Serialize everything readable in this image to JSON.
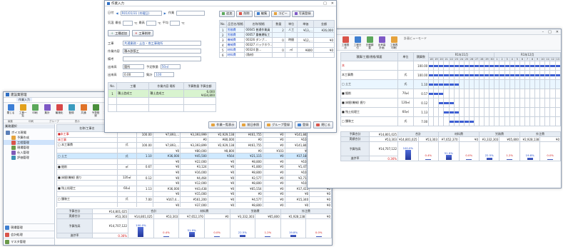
{
  "left_window": {
    "title": "建設業管理",
    "tab": "作業入力",
    "ribbon": [
      {
        "label": "閉じる",
        "color": "#3d7fd6"
      },
      {
        "label": "工事一覧",
        "color": "#e2a11c"
      },
      {
        "label": "印刷",
        "color": "#5ba85b"
      },
      {
        "label": "集計",
        "color": "#7e59c6"
      },
      {
        "label": "最適化",
        "color": "#d84848"
      },
      {
        "label": "登録",
        "color": "#3a9bbf"
      },
      {
        "label": "共通",
        "color": "#e07328"
      },
      {
        "label": "予算登録",
        "color": "#4a8f3c"
      },
      {
        "label": "実行予算",
        "color": "#c7499b"
      }
    ],
    "ribbon_groups": [
      "編集",
      "印刷",
      "グループ",
      "表示"
    ],
    "nav_title": "業務選択",
    "tree": [
      {
        "label": "ボイス現場",
        "level": 0
      },
      {
        "label": "予算作成",
        "level": 1
      },
      {
        "label": "工程管理",
        "level": 1
      },
      {
        "label": "現場管理",
        "level": 1
      },
      {
        "label": "仕入管理",
        "level": 1
      },
      {
        "label": "評価管理",
        "level": 1
      }
    ],
    "bottom_nav": [
      "現場管理",
      "会計処理",
      "マスタ管理"
    ]
  },
  "mid_table": {
    "headers": [
      "名称/工事名",
      "単位",
      "数量",
      "予算",
      "",
      "実行",
      "",
      "実績",
      "",
      "差額"
    ],
    "rows": [
      {
        "name": "■本工事",
        "unit": "",
        "qty": "100.00",
        "v1": "¥7,893,…",
        "v2": "¥3,393,999",
        "v3": "¥2,929,138",
        "v4": "¥461,755",
        "v5": "¥0",
        "v6": "¥141,844",
        "v7": "¥0",
        "cls": "red"
      },
      {
        "name": "床工事",
        "unit": "",
        "qty": "",
        "v1": "",
        "v2": "¥0",
        "v3": "¥80,000",
        "v4": "¥0",
        "v5": "¥0",
        "v6": "¥103",
        "v7": "¥0",
        "cls": "red"
      },
      {
        "name": "□ 本工事費",
        "unit": "式",
        "qty": "100.00",
        "v1": "¥7,893,…",
        "v2": "¥3,393,899",
        "v3": "¥2,929,138",
        "v4": "¥461,755",
        "v5": "¥0",
        "v6": "¥141,844",
        "v7": "¥0",
        "cls": ""
      },
      {
        "name": "",
        "unit": "",
        "qty": "",
        "v1": "¥0",
        "v2": "¥80,000",
        "v3": "¥8,800",
        "v4": "¥0",
        "v5": "¥103",
        "v6": "¥0",
        "v7": "",
        "cls": ""
      },
      {
        "name": "□ 土工",
        "unit": "式",
        "qty": "1.10",
        "v1": "¥36,000",
        "v2": "¥45,500",
        "v3": "¥564",
        "v4": "¥21,115",
        "v5": "¥0",
        "v6": "¥37,186",
        "v7": "¥0",
        "cls": "sel"
      },
      {
        "name": "",
        "unit": "",
        "qty": "",
        "v1": "¥0",
        "v2": "¥22,000",
        "v3": "¥0",
        "v4": "¥8,800",
        "v5": "¥0",
        "v6": "¥103",
        "v7": "¥0",
        "cls": ""
      },
      {
        "name": "■ 掘削",
        "unit": "㎥",
        "qty": "0.67",
        "v1": "¥0",
        "v2": "¥3,124",
        "v3": "¥0",
        "v4": "¥1,800",
        "v5": "¥0",
        "v6": "¥1,472",
        "v7": "¥0",
        "cls": ""
      },
      {
        "name": "",
        "unit": "",
        "qty": "",
        "v1": "¥0",
        "v2": "¥16,000",
        "v3": "¥0",
        "v4": "¥8,800",
        "v5": "¥0",
        "v6": "¥103",
        "v7": "¥0",
        "cls": ""
      },
      {
        "name": "■ 床掘(機械) 掘り",
        "unit": "120㎥",
        "qty": "0.12",
        "v1": "¥0",
        "v2": "¥4,464",
        "v3": "¥0",
        "v4": "¥2,577",
        "v5": "¥0",
        "v6": "¥2,711",
        "v7": "¥0",
        "cls": ""
      },
      {
        "name": "",
        "unit": "",
        "qty": "",
        "v1": "¥0",
        "v2": "¥12,000",
        "v3": "¥0",
        "v4": "¥8,800",
        "v5": "¥0",
        "v6": "¥103",
        "v7": "¥0",
        "cls": ""
      },
      {
        "name": "■ 残土処理工",
        "unit": "60㎥",
        "qty": "1.13",
        "v1": "¥36,000",
        "v2": "¥43,438",
        "v3": "¥0",
        "v4": "¥65,554",
        "v5": "¥0",
        "v6": "¥37,415",
        "v7": "¥0",
        "cls": ""
      },
      {
        "name": "",
        "unit": "",
        "qty": "",
        "v1": "¥0",
        "v2": "¥15,000",
        "v3": "¥0",
        "v4": "¥0",
        "v5": "¥0",
        "v6": "¥0",
        "v7": "¥0",
        "cls": ""
      },
      {
        "name": "□ 舗装工",
        "unit": "式",
        "qty": "7.00",
        "v1": "¥167,4…",
        "v2": "¥561,200",
        "v3": "¥0",
        "v4": "¥4,577",
        "v5": "¥0",
        "v6": "¥15,340",
        "v7": "¥0",
        "cls": ""
      },
      {
        "name": "",
        "unit": "",
        "qty": "",
        "v1": "¥0",
        "v2": "¥37,000",
        "v3": "¥0",
        "v4": "¥8,800",
        "v5": "¥0",
        "v6": "¥0",
        "v7": "¥0",
        "cls": ""
      }
    ]
  },
  "summary": {
    "labels": [
      "予算合計",
      "実績合計",
      "予算残高",
      "進捗率"
    ],
    "values": [
      "¥14,801,025",
      "¥53,303",
      "¥14,707,122",
      "0.36%"
    ],
    "groups": [
      "合計",
      "材料費",
      "労務費",
      "外注費"
    ],
    "sub": [
      "予算",
      "実績"
    ],
    "row1": [
      "¥14,801,025",
      "¥53,303",
      "¥7,652,370",
      "¥0",
      "¥3,332,303",
      "¥65,800",
      "¥2,928,138",
      "¥0"
    ],
    "pct": [
      "100.0%",
      "0.4%",
      "51.9%",
      "0.0%",
      "22.5%",
      "1.2%",
      "19.8%",
      "0.0%"
    ]
  },
  "dialog": {
    "title": "作業入力",
    "top_row": {
      "label1": "日付",
      "date": "R01/01/31 (木曜日)",
      "label2": "作業",
      "value2": ""
    },
    "row2": {
      "label": "気温",
      "v1": "最低",
      "v2": "℃",
      "v3": "最高",
      "v4": "℃",
      "v5": "平均",
      "v6": "℃"
    },
    "buttons_top": [
      "工種追加",
      "工事削除"
    ],
    "field_rows": [
      {
        "label": "工事",
        "value": "共通業務・土台・南工事務所"
      },
      {
        "label": "作業内容",
        "value": "積み鉄筋工"
      },
      {
        "label": "備考",
        "value": ""
      },
      {
        "label": "出来高",
        "value": "箇所",
        "extra1": "予定数量",
        "extra2": "50㎥"
      },
      {
        "label": "出来高",
        "value": "0.00",
        "extra1": "集計",
        "extra2": "100"
      }
    ],
    "grid_headers": [
      "No.",
      "工種",
      "作業内容 場所",
      "予算数量 予算金額"
    ],
    "grid_rows": [
      {
        "no": "1",
        "kind": "積土造成工",
        "place": "積土造成工",
        "qty": "6,000",
        "amt": "¥434,800"
      }
    ],
    "right_toolbar": [
      "追加",
      "削除",
      "編集",
      "コピー",
      "写真登録"
    ],
    "right_headers": [
      "No.",
      "品目名/規格",
      "名称/規格",
      "数量",
      "単位",
      "単価",
      "金額"
    ],
    "right_rows": [
      {
        "no": "1",
        "code": "労務費",
        "name": "00045 普通作業員",
        "qty": "2",
        "unit": "人工",
        "price": "¥13,…",
        "amount": "¥26,000"
      },
      {
        "no": "2",
        "code": "労務費",
        "name": "00057 重機運転工",
        "qty": "",
        "unit": "",
        "price": "",
        "amount": ""
      },
      {
        "no": "3",
        "code": "機械費",
        "name": "00326 ダンプ…",
        "qty": "0",
        "unit": "時間",
        "price": "¥12,…",
        "amount": "¥0"
      },
      {
        "no": "4",
        "code": "機械費",
        "name": "00327 バックホウ…",
        "qty": "",
        "unit": "",
        "price": "",
        "amount": ""
      },
      {
        "no": "5",
        "code": "材料費",
        "name": "00324 鉄…",
        "qty": "0",
        "unit": "㎥",
        "price": "¥800",
        "amount": "¥0"
      },
      {
        "no": "6",
        "code": "材料費",
        "name": "(角材)",
        "qty": "",
        "unit": "",
        "price": "",
        "amount": ""
      }
    ],
    "bottom_buttons": [
      "作業一覧表示",
      "前日参照",
      "グループ登録",
      "登録",
      "閉じる"
    ]
  },
  "gantt_window": {
    "tabs": [
      "工程表示",
      "工程日付",
      "日程調整",
      "出来高計画",
      "工程表印刷"
    ],
    "ribbon_right": "計画ビューモード",
    "headers": [
      "積算/工種/規格/摘要",
      "単位",
      "積算数",
      "R1年11月",
      "R1年12月"
    ],
    "days_nov": [
      "18",
      "19",
      "20",
      "21",
      "22",
      "23",
      "24",
      "25",
      "26",
      "27",
      "28",
      "29",
      "30"
    ],
    "days_dec": [
      "1",
      "2",
      "3",
      "4",
      "5",
      "6",
      "7",
      "8",
      "9",
      "10",
      "11",
      "12",
      "13"
    ],
    "rows": [
      {
        "name": "本",
        "unit": "",
        "qty": "100.00",
        "bar_start": 0,
        "bar_len": 26
      },
      {
        "name": "本工事費",
        "unit": "式",
        "qty": "100.00",
        "bar_start": 0,
        "bar_len": 26
      },
      {
        "name": "□ 土工",
        "unit": "式",
        "qty": "1.10",
        "bar_start": 0,
        "bar_len": 6
      },
      {
        "name": "■ 掘削",
        "unit": "70㎥",
        "qty": "0.57",
        "bar_start": 0,
        "bar_len": 3
      },
      {
        "name": "■ 床掘(機械) 掘り",
        "unit": "120㎥",
        "qty": "0.12",
        "bar_start": 2,
        "bar_len": 3
      },
      {
        "name": "■ 残土処理工",
        "unit": "60㎥",
        "qty": "1.13",
        "bar_start": 3,
        "bar_len": 3
      },
      {
        "name": "□ 舗装工",
        "unit": "式",
        "qty": "7.00",
        "bar_start": 4,
        "bar_len": 5
      }
    ],
    "summary_labels": [
      "予算合計",
      "実績合計",
      "予算残高",
      "進捗率"
    ],
    "summary_values": [
      "¥14,801,025",
      "¥53,303",
      "¥14,707,122",
      "0.36%"
    ],
    "groups": [
      "合計",
      "材料費",
      "労務費",
      "外注費"
    ],
    "row1": [
      "¥14,801,025",
      "¥53,303",
      "¥7,652,370",
      "¥0",
      "¥3,332,303",
      "¥65,800",
      "¥2,928,138",
      "¥0"
    ],
    "pct": [
      "100.0%",
      "0.4%",
      "51.9%",
      "0.0%",
      "22.5%",
      "1.2%",
      "19.8%",
      "0.0%"
    ]
  }
}
